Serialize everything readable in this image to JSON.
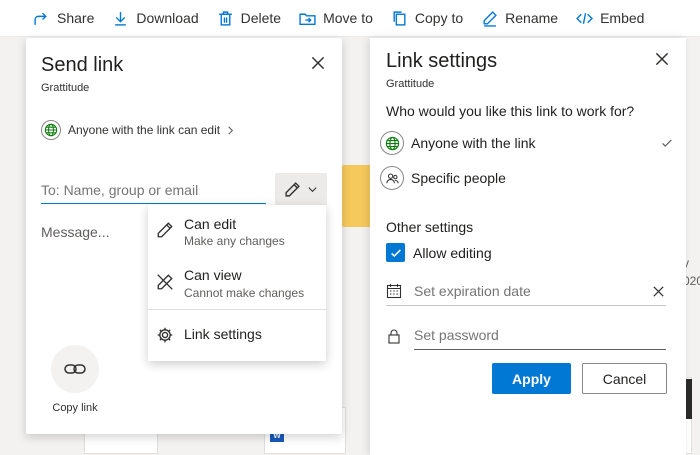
{
  "toolbar": {
    "items": [
      {
        "label": "Share",
        "icon": "share-icon"
      },
      {
        "label": "Download",
        "icon": "download-icon"
      },
      {
        "label": "Delete",
        "icon": "delete-icon"
      },
      {
        "label": "Move to",
        "icon": "move-icon"
      },
      {
        "label": "Copy to",
        "icon": "copy-icon"
      },
      {
        "label": "Rename",
        "icon": "rename-icon"
      },
      {
        "label": "Embed",
        "icon": "embed-icon"
      }
    ]
  },
  "background": {
    "right_text_1": "y",
    "right_text_2": "020",
    "word_badge": "W"
  },
  "send_link": {
    "title": "Send link",
    "subtitle": "Grattitude",
    "permission": "Anyone with the link can edit",
    "to_placeholder": "To: Name, group or email",
    "message_placeholder": "Message...",
    "copy_link_label": "Copy link"
  },
  "dropdown": {
    "items": [
      {
        "title": "Can edit",
        "desc": "Make any changes",
        "icon": "pencil-icon"
      },
      {
        "title": "Can view",
        "desc": "Cannot make changes",
        "icon": "no-edit-icon"
      },
      {
        "title": "Link settings",
        "desc": "",
        "icon": "gear-icon"
      }
    ]
  },
  "link_settings": {
    "title": "Link settings",
    "subtitle": "Grattitude",
    "question": "Who would you like this link to work for?",
    "options": [
      {
        "label": "Anyone with the link",
        "selected": true
      },
      {
        "label": "Specific people",
        "selected": false
      }
    ],
    "other_heading": "Other settings",
    "allow_editing": {
      "label": "Allow editing",
      "checked": true
    },
    "expiration_placeholder": "Set expiration date",
    "password_placeholder": "Set password",
    "apply_label": "Apply",
    "cancel_label": "Cancel"
  },
  "colors": {
    "accent": "#0078d4",
    "folder": "#f6c95c",
    "word": "#185abd"
  }
}
